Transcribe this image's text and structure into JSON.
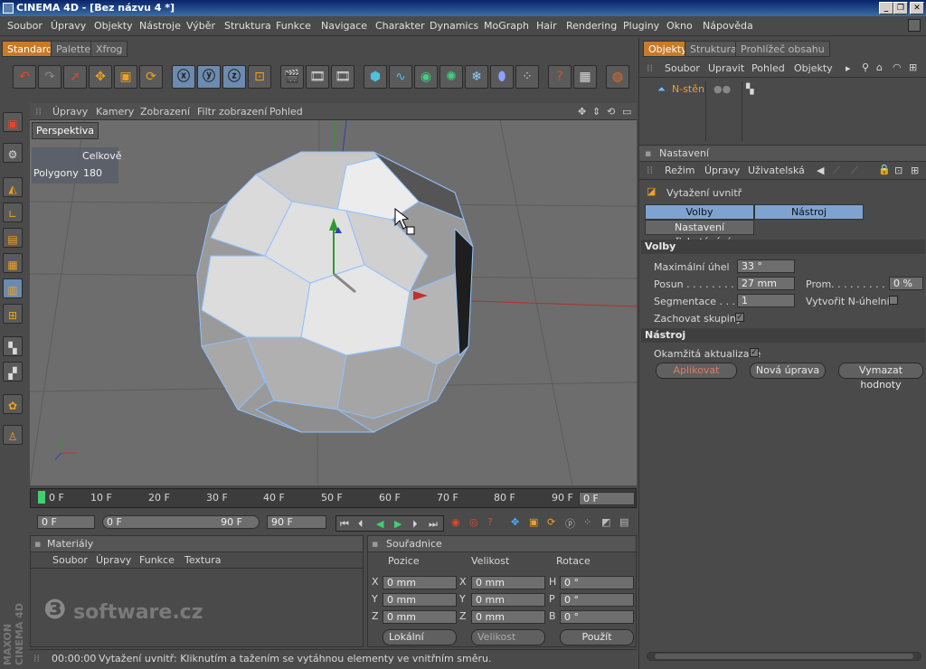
{
  "window": {
    "title": "CINEMA 4D - [Bez názvu 4 *]"
  },
  "menu": [
    "Soubor",
    "Úpravy",
    "Objekty",
    "Nástroje",
    "Výběr",
    "Struktura",
    "Funkce",
    "Navigace",
    "Charakter",
    "Dynamics",
    "MoGraph",
    "Hair",
    "Rendering",
    "Pluginy",
    "Okno",
    "Nápověda"
  ],
  "layout_tabs": [
    "Standard",
    "Palette",
    "Xfrog"
  ],
  "viewport": {
    "menu": [
      "Úpravy",
      "Kamery",
      "Zobrazení",
      "Filtr zobrazení",
      "Pohled"
    ],
    "label": "Perspektiva",
    "stats_header": "Celkově",
    "stats_label": "Polygony",
    "stats_value": "180"
  },
  "timeline": {
    "ticks": [
      "0 F",
      "10 F",
      "20 F",
      "30 F",
      "40 F",
      "50 F",
      "60 F",
      "70 F",
      "80 F",
      "90 F"
    ],
    "current": "0 F",
    "start": "0 F",
    "range_start": "0 F",
    "range_end": "90 F",
    "end": "90 F"
  },
  "materials": {
    "title": "Materiály",
    "menu": [
      "Soubor",
      "Úpravy",
      "Funkce",
      "Textura"
    ]
  },
  "coords": {
    "title": "Souřadnice",
    "headers": [
      "Pozice",
      "Velikost",
      "Rotace"
    ],
    "rows": [
      {
        "a": "X",
        "av": "0 mm",
        "b": "X",
        "bv": "0 mm",
        "c": "H",
        "cv": "0 °"
      },
      {
        "a": "Y",
        "av": "0 mm",
        "b": "Y",
        "bv": "0 mm",
        "c": "P",
        "cv": "0 °"
      },
      {
        "a": "Z",
        "av": "0 mm",
        "b": "Z",
        "bv": "0 mm",
        "c": "B",
        "cv": "0 °"
      }
    ],
    "mode": "Lokální",
    "size_mode": "Velikost",
    "apply": "Použít"
  },
  "status": {
    "time": "00:00:00",
    "text": "Vytažení uvnitř: Kliknutím a tažením se vytáhnou elementy ve vnitřním směru."
  },
  "objects": {
    "tabs": [
      "Objekty",
      "Struktura",
      "Prohlížeč obsahu"
    ],
    "menu": [
      "Soubor",
      "Upravit",
      "Pohled",
      "Objekty"
    ],
    "item": "N-stěn"
  },
  "attributes": {
    "title": "Nastavení",
    "menu": [
      "Režim",
      "Úpravy",
      "Uživatelská"
    ],
    "tool_name": "Vytažení uvnitř",
    "tabs": [
      "Volby",
      "Nástroj"
    ],
    "snap_tab": "Nastavení přichytávání",
    "section_options": "Volby",
    "max_angle_label": "Maximální úhel",
    "max_angle": "33 °",
    "offset_label": "Posun . . . . . . . .",
    "offset": "27 mm",
    "var_label": "Prom. . . . . . . . . . . .",
    "var": "0 %",
    "segments_label": "Segmentace . . .",
    "segments": "1",
    "ngons_label": "Vytvořit N-úhelník",
    "keep_groups_label": "Zachovat skupiny",
    "section_tool": "Nástroj",
    "realtime_label": "Okamžitá aktualizace",
    "apply": "Aplikovat",
    "new": "Nová úprava",
    "reset": "Vymazat hodnoty"
  },
  "watermark": {
    "brand": "software.cz",
    "vertical": "MAXON CINEMA 4D"
  },
  "colors": {
    "accent": "#c87a28",
    "selected_tab": "#7fa3cf",
    "title_bar": "#0a246a"
  }
}
